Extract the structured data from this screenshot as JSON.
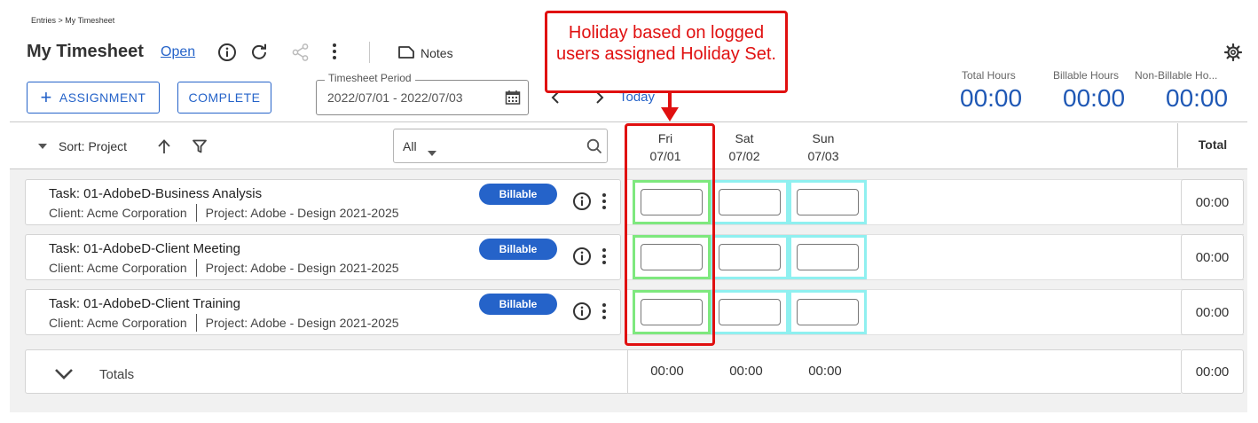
{
  "breadcrumb": "Entries > My Timesheet",
  "page_title": "My Timesheet",
  "status": "Open",
  "toolbar": {
    "notes_label": "Notes"
  },
  "actions": {
    "assignment_label": "ASSIGNMENT",
    "complete_label": "COMPLETE"
  },
  "period": {
    "legend": "Timesheet Period",
    "value": "2022/07/01 - 2022/07/03"
  },
  "nav": {
    "today_label": "Today"
  },
  "summary": {
    "total_label": "Total Hours",
    "total_value": "00:00",
    "billable_label": "Billable Hours",
    "billable_value": "00:00",
    "nonbillable_label": "Non-Billable Ho...",
    "nonbillable_value": "00:00"
  },
  "table": {
    "sort_label": "Sort: Project",
    "filter_value": "All",
    "total_header": "Total",
    "days": [
      {
        "name": "Fri",
        "date": "07/01"
      },
      {
        "name": "Sat",
        "date": "07/02"
      },
      {
        "name": "Sun",
        "date": "07/03"
      }
    ],
    "rows": [
      {
        "task": "Task: 01-AdobeD-Business Analysis",
        "client": "Client: Acme Corporation",
        "project": "Project: Adobe - Design 2021-2025",
        "badge": "Billable",
        "total": "00:00"
      },
      {
        "task": "Task: 01-AdobeD-Client Meeting",
        "client": "Client: Acme Corporation",
        "project": "Project: Adobe - Design 2021-2025",
        "badge": "Billable",
        "total": "00:00"
      },
      {
        "task": "Task: 01-AdobeD-Client Training",
        "client": "Client: Acme Corporation",
        "project": "Project: Adobe - Design 2021-2025",
        "badge": "Billable",
        "total": "00:00"
      }
    ],
    "totals": {
      "label": "Totals",
      "day_values": [
        "00:00",
        "00:00",
        "00:00"
      ],
      "grand_total": "00:00"
    }
  },
  "annotation": {
    "text": "Holiday based on logged users assigned Holiday Set."
  },
  "colors": {
    "accent": "#2563c9",
    "annotation": "#e01010",
    "holiday_cell": "#7ee87e",
    "weekend_cell": "#8ff0f0"
  }
}
